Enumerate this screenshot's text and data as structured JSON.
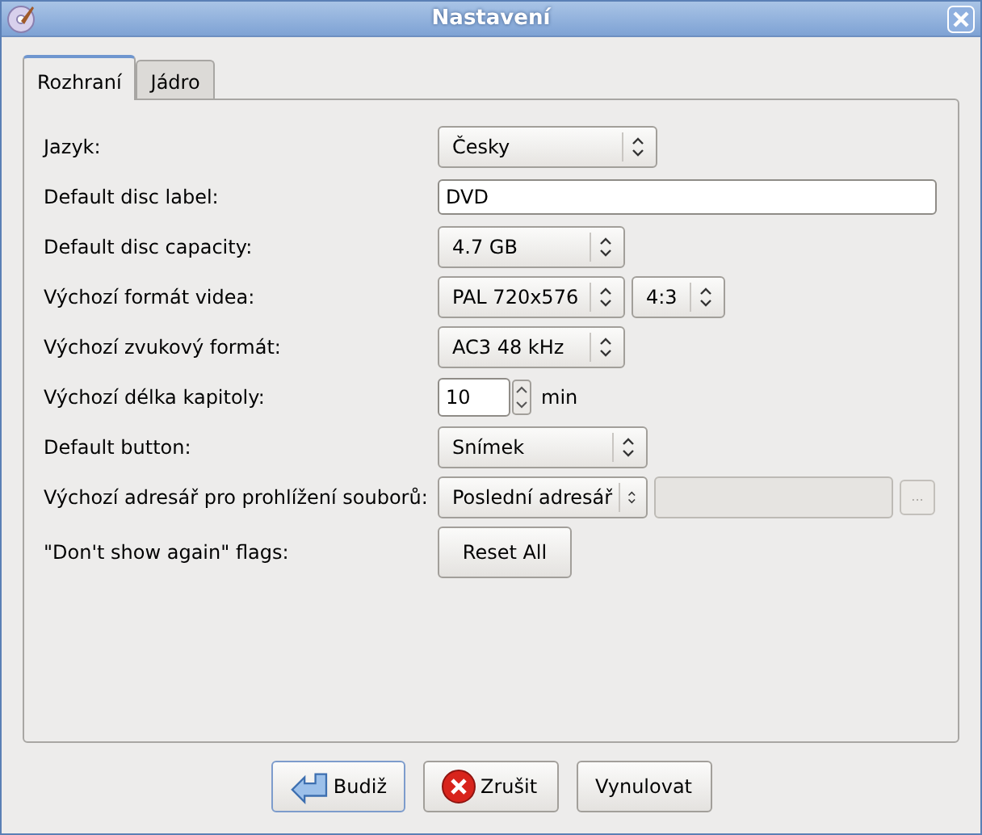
{
  "window": {
    "title": "Nastavení"
  },
  "tabs": [
    {
      "label": "Rozhraní",
      "selected": true
    },
    {
      "label": "Jádro",
      "selected": false
    }
  ],
  "rows": [
    {
      "label": "Jazyk:",
      "controls": [
        {
          "kind": "combo",
          "value": "Česky"
        }
      ]
    },
    {
      "label": "Default disc label:",
      "controls": [
        {
          "kind": "text",
          "value": "DVD"
        }
      ]
    },
    {
      "label": "Default disc capacity:",
      "controls": [
        {
          "kind": "combo",
          "value": "4.7 GB"
        }
      ]
    },
    {
      "label": "Výchozí formát videa:",
      "controls": [
        {
          "kind": "combo",
          "value": "PAL 720x576"
        },
        {
          "kind": "combo",
          "value": "4:3"
        }
      ]
    },
    {
      "label": "Výchozí zvukový formát:",
      "controls": [
        {
          "kind": "combo",
          "value": "AC3 48 kHz"
        }
      ]
    },
    {
      "label": "Výchozí délka kapitoly:",
      "controls": [
        {
          "kind": "spin",
          "value": "10"
        },
        {
          "kind": "unit",
          "value": "min"
        }
      ]
    },
    {
      "label": "Default button:",
      "controls": [
        {
          "kind": "combo",
          "value": "Snímek"
        }
      ]
    },
    {
      "label": "Výchozí adresář pro prohlížení souborů:",
      "controls": [
        {
          "kind": "combo",
          "value": "Poslední adresář"
        },
        {
          "kind": "path",
          "disabled": true
        },
        {
          "kind": "browse",
          "value": "...",
          "disabled": true
        }
      ]
    },
    {
      "label": "\"Don't show again\" flags:",
      "controls": [
        {
          "kind": "button",
          "value": "Reset All"
        }
      ]
    }
  ],
  "buttons": [
    {
      "label": "Budiž",
      "kind": "ok",
      "focused": true
    },
    {
      "label": "Zrušit",
      "kind": "cancel",
      "focused": false
    },
    {
      "label": "Vynulovat",
      "kind": "reset",
      "focused": false
    }
  ]
}
